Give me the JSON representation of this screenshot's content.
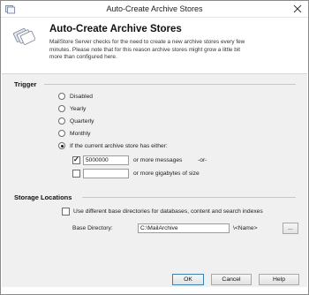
{
  "window": {
    "title": "Auto-Create Archive Stores"
  },
  "header": {
    "title": "Auto-Create Archive Stores",
    "description": "MailStore Server checks for the need to create a new archive stores every few minutes. Please note that for this reason archive stores might grow a little bit more than configured here."
  },
  "trigger": {
    "section_label": "Trigger",
    "options": [
      {
        "label": "Disabled",
        "checked": false
      },
      {
        "label": "Yearly",
        "checked": false
      },
      {
        "label": "Quarterly",
        "checked": false
      },
      {
        "label": "Monthly",
        "checked": false
      },
      {
        "label": "If the current archive store has either:",
        "checked": true
      }
    ],
    "messages": {
      "checked": true,
      "value": "5000000",
      "suffix": "or more messages",
      "or": "-or-"
    },
    "gigabytes": {
      "checked": false,
      "value": "",
      "suffix": "or more gigabytes of size"
    }
  },
  "storage": {
    "section_label": "Storage Locations",
    "different_dirs_label": "Use different base directories for databases, content and search indexes",
    "different_dirs_checked": false,
    "base_dir_label": "Base Directory:",
    "base_dir_value": "C:\\MailArchive",
    "name_suffix": "\\<Name>",
    "browse_label": "..."
  },
  "buttons": {
    "ok": "OK",
    "cancel": "Cancel",
    "help": "Help"
  },
  "colors": {
    "accent": "#3c7fb1",
    "panel": "#f0f0f0",
    "header_bg": "#ffffff"
  }
}
